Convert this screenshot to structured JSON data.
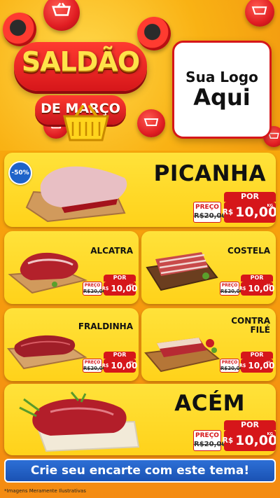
{
  "header": {
    "badge_line1": "SALDÃO",
    "badge_line2": "DE MARÇO",
    "logo_line1": "Sua Logo",
    "logo_line2": "Aqui"
  },
  "colors": {
    "background": "#f8a70c",
    "card": "#ffd21a",
    "accent_red": "#d6161a",
    "cta_blue": "#1a52b3"
  },
  "products": {
    "picanha": {
      "name": "PICANHA",
      "discount": "-50%",
      "por": "POR",
      "preco": "PREÇO",
      "old_price": "R$20,00",
      "currency": "R$",
      "new_price": "10,00",
      "unit": "KG"
    },
    "alcatra": {
      "name": "ALCATRA",
      "por": "POR",
      "preco": "PREÇO",
      "old_price": "R$20,00",
      "currency": "R$",
      "new_price": "10,00",
      "unit": "KG"
    },
    "costela": {
      "name": "COSTELA",
      "por": "POR",
      "preco": "PREÇO",
      "old_price": "R$20,00",
      "currency": "R$",
      "new_price": "10,00",
      "unit": "KG"
    },
    "fraldinha": {
      "name": "FRALDINHA",
      "por": "POR",
      "preco": "PREÇO",
      "old_price": "R$20,00",
      "currency": "R$",
      "new_price": "10,00",
      "unit": "KG"
    },
    "contra_file": {
      "name_line1": "CONTRA",
      "name_line2": "FILÉ",
      "por": "POR",
      "preco": "PREÇO",
      "old_price": "R$20,00",
      "currency": "R$",
      "new_price": "10,00",
      "unit": "KG"
    },
    "acem": {
      "name": "ACÉM",
      "por": "POR",
      "preco": "PREÇO",
      "old_price": "R$20,00",
      "currency": "R$",
      "new_price": "10,00",
      "unit": "KG"
    }
  },
  "footer": {
    "cta": "Crie seu encarte com este tema!",
    "disclaimer": "*Imagens Meramente Ilustrativas"
  }
}
